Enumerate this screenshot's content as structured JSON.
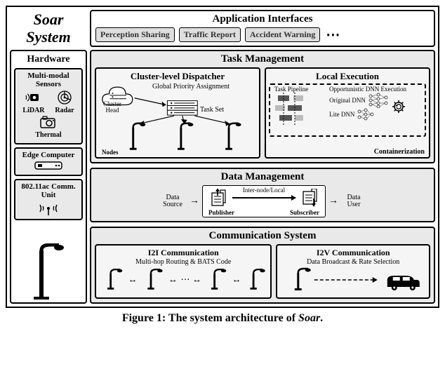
{
  "system_title": "Soar System",
  "application_interfaces": {
    "title": "Application Interfaces",
    "items": [
      "Perception Sharing",
      "Traffic Report",
      "Accident Warning"
    ],
    "more": "⋯"
  },
  "hardware": {
    "title": "Hardware",
    "sensors": {
      "title": "Multi-modal Sensors",
      "lidar": "LiDAR",
      "radar": "Radar",
      "thermal": "Thermal"
    },
    "edge": {
      "title": "Edge Computer"
    },
    "comm": {
      "title": "802.11ac Comm. Unit"
    }
  },
  "task_management": {
    "title": "Task Management",
    "dispatcher": {
      "title": "Cluster-level Dispatcher",
      "global_priority": "Global Priority Assignment",
      "task_set": "Task Set",
      "cluster_head": "Cluster Head",
      "nodes": "Nodes"
    },
    "local_exec": {
      "title": "Local Execution",
      "task_pipeline": "Task Pipeline",
      "opp_dnn": "Opportunistic DNN Execution",
      "original_dnn": "Original DNN",
      "lite_dnn": "Lite DNN",
      "containerization": "Containerization"
    }
  },
  "data_management": {
    "title": "Data Management",
    "data_source": "Data Source",
    "publisher": "Publisher",
    "inter_node": "Inter-node/Local",
    "subscriber": "Subscriber",
    "data_user": "Data User"
  },
  "communication_system": {
    "title": "Communication System",
    "i2i": {
      "title": "I2I Communication",
      "subtitle": "Multi-hop Routing & BATS Code"
    },
    "i2v": {
      "title": "I2V Communication",
      "subtitle": "Data Broadcast & Rate Selection"
    }
  },
  "caption": {
    "prefix": "Figure 1: The system architecture of ",
    "name": "Soar",
    "suffix": "."
  }
}
